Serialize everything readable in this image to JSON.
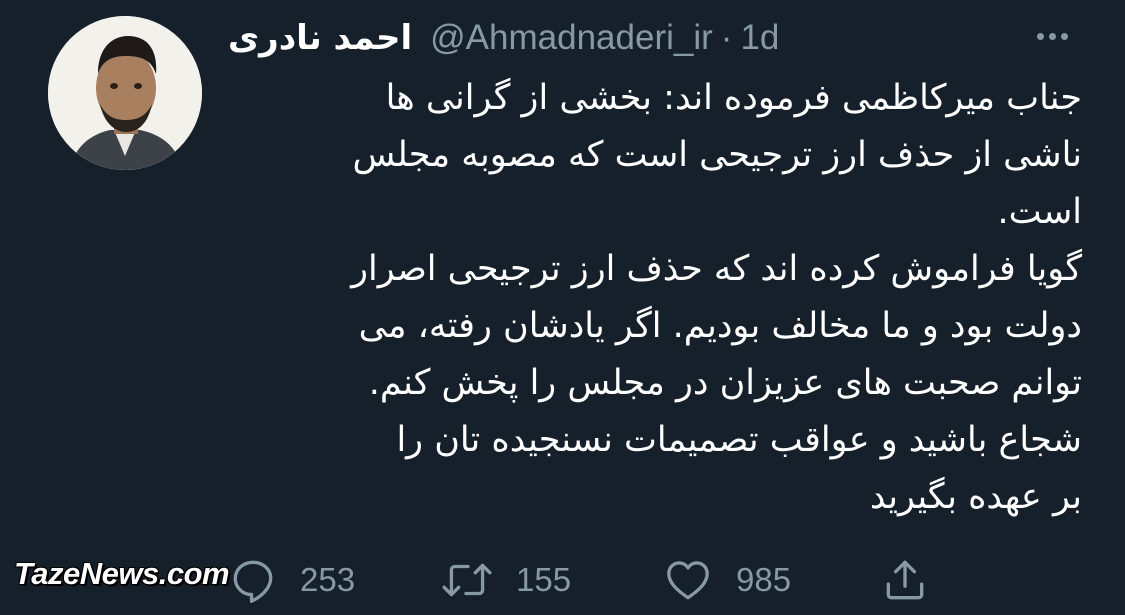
{
  "author": {
    "name": "احمد نادری",
    "handle": "@Ahmadnaderi_ir",
    "separator": "·",
    "time": "1d"
  },
  "tweet_lines": [
    "جناب میرکاظمی فرموده اند: بخشی از گرانی ها",
    "ناشی از حذف ارز ترجیحی است که مصوبه مجلس",
    "است.",
    "گویا فراموش کرده اند که حذف ارز ترجیحی اصرار",
    "دولت بود و ما مخالف بودیم. اگر یادشان رفته، می",
    "توانم صحبت های عزیزان در مجلس را پخش کنم.",
    "شجاع باشید و عواقب تصمیمات نسنجیده تان را",
    "بر عهده بگیرید"
  ],
  "actions": {
    "reply": {
      "icon": "reply-icon",
      "count": "253"
    },
    "retweet": {
      "icon": "retweet-icon",
      "count": "155"
    },
    "like": {
      "icon": "heart-icon",
      "count": "985"
    },
    "share": {
      "icon": "share-icon"
    }
  },
  "watermark": "TazeNews.com",
  "colors": {
    "background": "#15202b",
    "text": "#ffffff",
    "secondary": "#8899a6"
  }
}
